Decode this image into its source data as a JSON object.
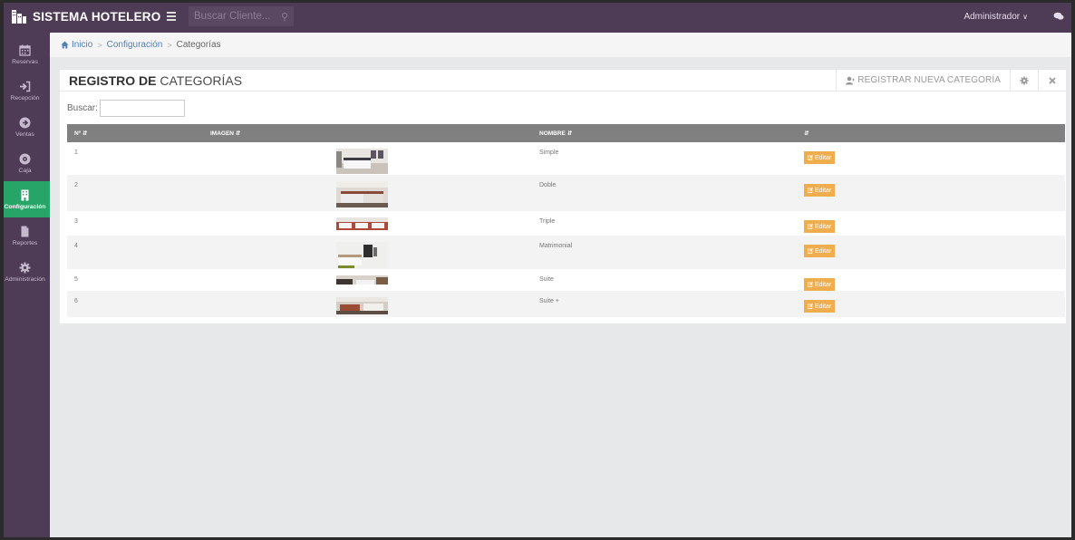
{
  "topbar": {
    "brand": "SISTEMA HOTELERO",
    "search_placeholder": "Buscar Cliente...",
    "user": "Administrador"
  },
  "sidebar": {
    "items": [
      {
        "label": "Reservas",
        "icon": "calendar-icon"
      },
      {
        "label": "Recepción",
        "icon": "sign-in-icon"
      },
      {
        "label": "Ventas",
        "icon": "arrow-circle-icon"
      },
      {
        "label": "Caja",
        "icon": "safe-icon"
      },
      {
        "label": "Configuración",
        "icon": "building-icon",
        "active": true
      },
      {
        "label": "Reportes",
        "icon": "file-icon"
      },
      {
        "label": "Administración",
        "icon": "gear-icon"
      }
    ]
  },
  "breadcrumb": {
    "home": "Inicio",
    "section": "Configuración",
    "current": "Categorías"
  },
  "panel": {
    "title_bold": "REGISTRO DE",
    "title_rest": " CATEGORÍAS",
    "new_label": "REGISTRAR NUEVA CATEGORÍA",
    "search_label": "Buscar:"
  },
  "table": {
    "headers": {
      "no": "Nº",
      "image": "IMAGEN",
      "name": "NOMBRE",
      "actions": ""
    },
    "edit_label": "Editar",
    "rows": [
      {
        "no": "1",
        "name": "Simple"
      },
      {
        "no": "2",
        "name": "Doble"
      },
      {
        "no": "3",
        "name": "Triple"
      },
      {
        "no": "4",
        "name": "Matrimonial"
      },
      {
        "no": "5",
        "name": "Suite"
      },
      {
        "no": "6",
        "name": "Suite +"
      }
    ]
  },
  "colors": {
    "topbar": "#4e3b55",
    "active_menu": "#27a468",
    "edit_button": "#f0ad4e",
    "table_header": "#808080"
  }
}
